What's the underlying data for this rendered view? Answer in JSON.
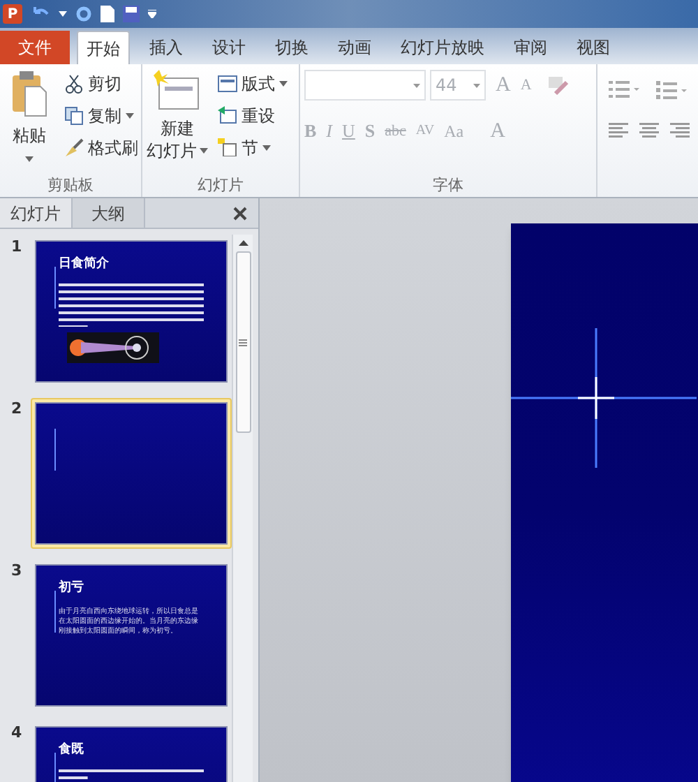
{
  "app_logo": "P",
  "ribbon_tabs": [
    {
      "label": "文件",
      "kind": "file",
      "selected": false
    },
    {
      "label": "开始",
      "kind": "tab",
      "selected": true
    },
    {
      "label": "插入",
      "kind": "tab",
      "selected": false
    },
    {
      "label": "设计",
      "kind": "tab",
      "selected": false
    },
    {
      "label": "切换",
      "kind": "tab",
      "selected": false
    },
    {
      "label": "动画",
      "kind": "tab",
      "selected": false
    },
    {
      "label": "幻灯片放映",
      "kind": "tab",
      "selected": false
    },
    {
      "label": "审阅",
      "kind": "tab",
      "selected": false
    },
    {
      "label": "视图",
      "kind": "tab",
      "selected": false
    }
  ],
  "clipboard_group": {
    "label": "剪贴板",
    "paste": "粘贴",
    "cut": "剪切",
    "copy": "复制",
    "format_painter": "格式刷"
  },
  "slides_group": {
    "label": "幻灯片",
    "new_slide": [
      "新建",
      "幻灯片"
    ],
    "layout": "版式",
    "reset": "重设",
    "section": "节"
  },
  "font_group": {
    "label": "字体",
    "disabled": true,
    "size": "44",
    "grow": "A",
    "shrink": "A",
    "format_buttons": [
      "B",
      "I",
      "U",
      "S",
      "abc",
      "AV",
      "Aa",
      "A"
    ]
  },
  "pane_tabs": [
    {
      "label": "幻灯片",
      "selected": true
    },
    {
      "label": "大纲",
      "selected": false
    }
  ],
  "slides": [
    {
      "number": "1",
      "title": "日食简介",
      "selected": false,
      "kind": "picture"
    },
    {
      "number": "2",
      "selected": true,
      "kind": "blank"
    },
    {
      "number": "3",
      "title": "初亏",
      "body": "由于月亮自西向东绕地球运转，所以日食总是在太阳圆面的西边缘开始的。当月亮的东边缘刚接触到太阳圆面的瞬间，称为初亏。",
      "selected": false,
      "kind": "text"
    },
    {
      "number": "4",
      "title": "食既",
      "selected": false,
      "kind": "text"
    }
  ]
}
